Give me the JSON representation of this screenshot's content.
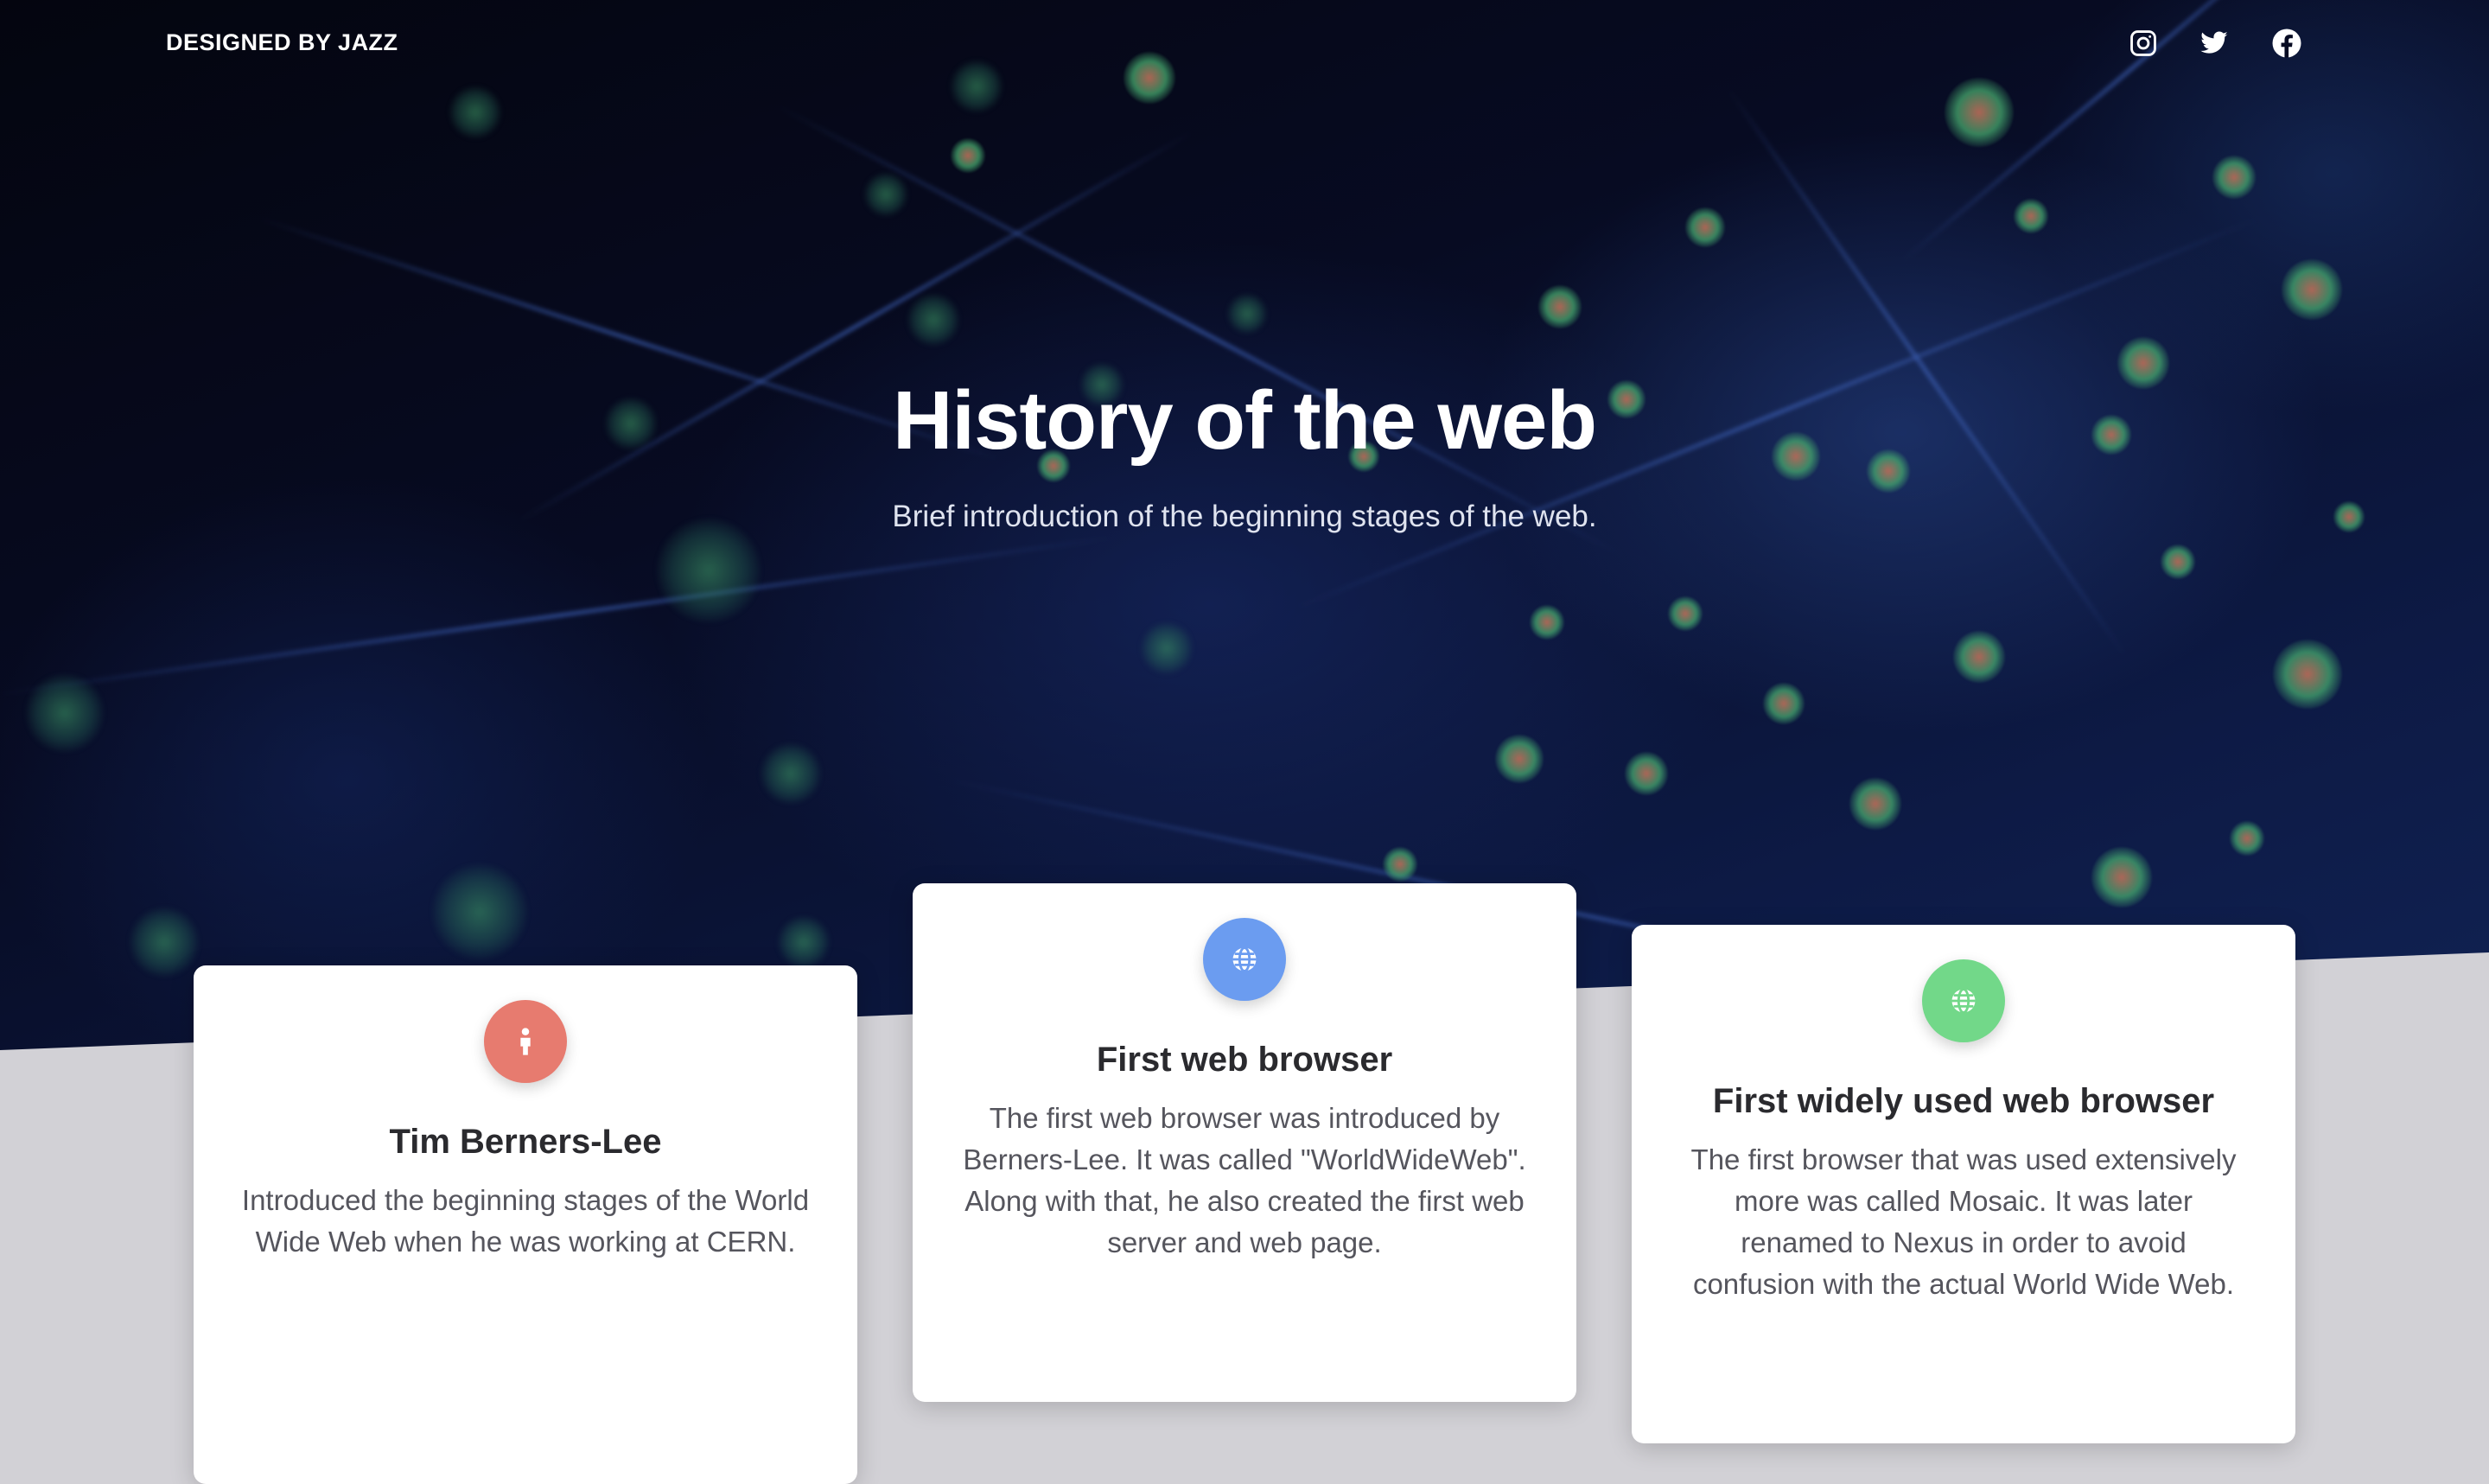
{
  "header": {
    "brand": "DESIGNED BY JAZZ",
    "social": [
      {
        "icon": "instagram-icon"
      },
      {
        "icon": "twitter-icon"
      },
      {
        "icon": "facebook-icon"
      }
    ]
  },
  "hero": {
    "title": "History of the web",
    "subtitle": "Brief introduction of the beginning stages of the web."
  },
  "cards": [
    {
      "icon": "person-icon",
      "color": "#e77b6f",
      "title": "Tim Berners-Lee",
      "text": "Introduced the beginning stages of the World Wide Web when he was working at CERN."
    },
    {
      "icon": "globe-icon",
      "color": "#6b9cf0",
      "title": "First web browser",
      "text": "The first web browser was introduced by Berners-Lee. It was called \"WorldWideWeb\". Along with that, he also created the first web server and web page."
    },
    {
      "icon": "globe-icon",
      "color": "#72d889",
      "title": "First widely used web browser",
      "text": "The first browser that was used extensively more was called Mosaic. It was later renamed to Nexus in order to avoid confusion with the actual World Wide Web."
    }
  ]
}
